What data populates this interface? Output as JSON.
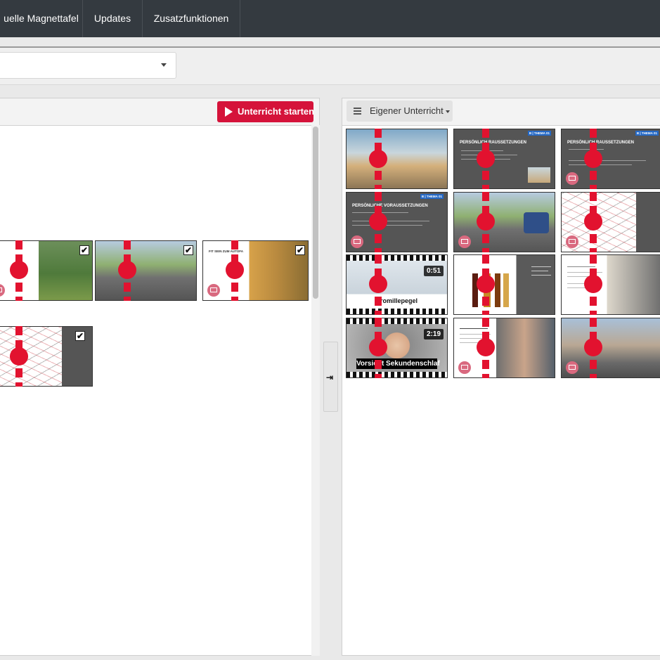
{
  "nav": {
    "items": [
      "uelle Magnettafel",
      "Updates",
      "Zusatzfunktionen"
    ]
  },
  "toolbar": {
    "select_value": ""
  },
  "left_panel": {
    "start_button_label": "Unterricht starten"
  },
  "right_panel": {
    "menu_label": "Eigener Unterricht"
  },
  "collapse_icon": "⇥",
  "tiles": {
    "right": {
      "slide_title": "PERSÖNLICHE VORAUSSETZUNGEN",
      "slide_title_short": "PERSÖNLICH      RAUSSETZUNGEN",
      "badge": "B | THEMA 01",
      "video1_duration": "0:51",
      "video1_caption": "Promillepegel",
      "video2_duration": "2:19",
      "video2_caption": "Vorsicht Sekundenschlaf"
    },
    "left": {
      "slide3_title": "FIT SEIN ZUM AUTOFA"
    }
  },
  "icons": {
    "check": "✔"
  },
  "colors": {
    "nav_bg": "#343a40",
    "accent_red": "#d5133a",
    "marker_red": "#e2122f"
  }
}
